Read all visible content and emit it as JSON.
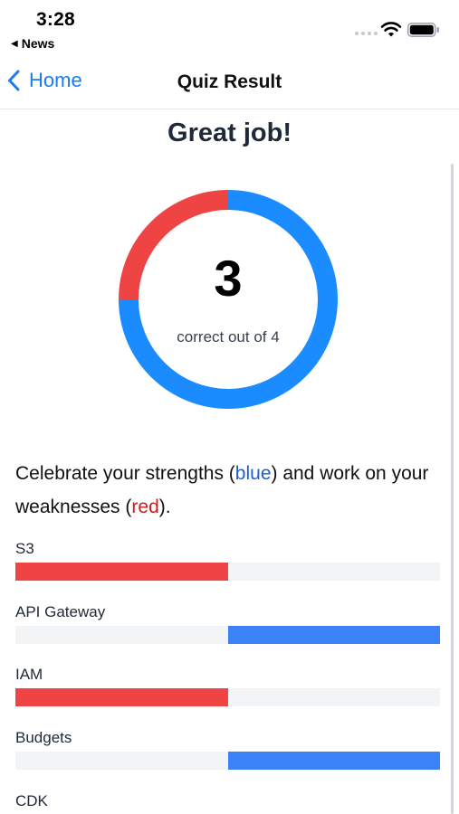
{
  "status_bar": {
    "time": "3:28",
    "back_app": "News"
  },
  "nav": {
    "back_label": "Home",
    "title": "Quiz Result"
  },
  "result": {
    "headline": "Great job!",
    "correct": 3,
    "total": 4,
    "caption": "correct out of 4"
  },
  "summary": {
    "prefix": "Celebrate your strengths (",
    "strength_word": "blue",
    "middle": ") and work on your weaknesses (",
    "weakness_word": "red",
    "suffix": ")."
  },
  "colors": {
    "strength": "#3b82f6",
    "weakness": "#ef4444",
    "ring_blue": "#1a8cff",
    "ring_red": "#ef4444",
    "track": "#f3f4f6",
    "accent": "#1a7cf0"
  },
  "topics": [
    {
      "name": "S3",
      "result": "weakness"
    },
    {
      "name": "API Gateway",
      "result": "strength"
    },
    {
      "name": "IAM",
      "result": "weakness"
    },
    {
      "name": "Budgets",
      "result": "strength"
    },
    {
      "name": "CDK",
      "result": ""
    }
  ],
  "icons": {
    "status_back": "back-triangle-icon",
    "wifi": "wifi-icon",
    "battery": "battery-icon",
    "nav_back": "chevron-left-icon"
  }
}
